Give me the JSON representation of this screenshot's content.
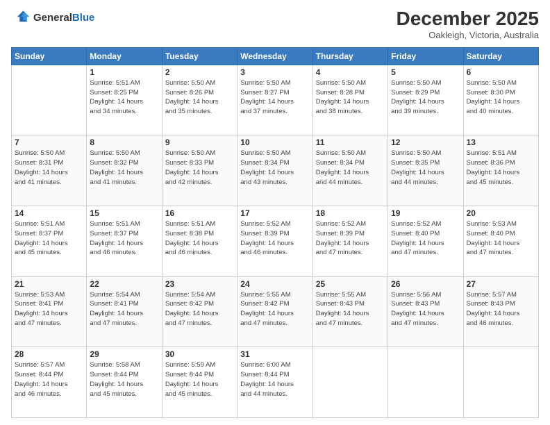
{
  "header": {
    "logo_line1": "General",
    "logo_line2": "Blue",
    "month": "December 2025",
    "location": "Oakleigh, Victoria, Australia"
  },
  "weekdays": [
    "Sunday",
    "Monday",
    "Tuesday",
    "Wednesday",
    "Thursday",
    "Friday",
    "Saturday"
  ],
  "weeks": [
    [
      {
        "day": "",
        "info": ""
      },
      {
        "day": "1",
        "info": "Sunrise: 5:51 AM\nSunset: 8:25 PM\nDaylight: 14 hours\nand 34 minutes."
      },
      {
        "day": "2",
        "info": "Sunrise: 5:50 AM\nSunset: 8:26 PM\nDaylight: 14 hours\nand 35 minutes."
      },
      {
        "day": "3",
        "info": "Sunrise: 5:50 AM\nSunset: 8:27 PM\nDaylight: 14 hours\nand 37 minutes."
      },
      {
        "day": "4",
        "info": "Sunrise: 5:50 AM\nSunset: 8:28 PM\nDaylight: 14 hours\nand 38 minutes."
      },
      {
        "day": "5",
        "info": "Sunrise: 5:50 AM\nSunset: 8:29 PM\nDaylight: 14 hours\nand 39 minutes."
      },
      {
        "day": "6",
        "info": "Sunrise: 5:50 AM\nSunset: 8:30 PM\nDaylight: 14 hours\nand 40 minutes."
      }
    ],
    [
      {
        "day": "7",
        "info": "Sunrise: 5:50 AM\nSunset: 8:31 PM\nDaylight: 14 hours\nand 41 minutes."
      },
      {
        "day": "8",
        "info": "Sunrise: 5:50 AM\nSunset: 8:32 PM\nDaylight: 14 hours\nand 41 minutes."
      },
      {
        "day": "9",
        "info": "Sunrise: 5:50 AM\nSunset: 8:33 PM\nDaylight: 14 hours\nand 42 minutes."
      },
      {
        "day": "10",
        "info": "Sunrise: 5:50 AM\nSunset: 8:34 PM\nDaylight: 14 hours\nand 43 minutes."
      },
      {
        "day": "11",
        "info": "Sunrise: 5:50 AM\nSunset: 8:34 PM\nDaylight: 14 hours\nand 44 minutes."
      },
      {
        "day": "12",
        "info": "Sunrise: 5:50 AM\nSunset: 8:35 PM\nDaylight: 14 hours\nand 44 minutes."
      },
      {
        "day": "13",
        "info": "Sunrise: 5:51 AM\nSunset: 8:36 PM\nDaylight: 14 hours\nand 45 minutes."
      }
    ],
    [
      {
        "day": "14",
        "info": "Sunrise: 5:51 AM\nSunset: 8:37 PM\nDaylight: 14 hours\nand 45 minutes."
      },
      {
        "day": "15",
        "info": "Sunrise: 5:51 AM\nSunset: 8:37 PM\nDaylight: 14 hours\nand 46 minutes."
      },
      {
        "day": "16",
        "info": "Sunrise: 5:51 AM\nSunset: 8:38 PM\nDaylight: 14 hours\nand 46 minutes."
      },
      {
        "day": "17",
        "info": "Sunrise: 5:52 AM\nSunset: 8:39 PM\nDaylight: 14 hours\nand 46 minutes."
      },
      {
        "day": "18",
        "info": "Sunrise: 5:52 AM\nSunset: 8:39 PM\nDaylight: 14 hours\nand 47 minutes."
      },
      {
        "day": "19",
        "info": "Sunrise: 5:52 AM\nSunset: 8:40 PM\nDaylight: 14 hours\nand 47 minutes."
      },
      {
        "day": "20",
        "info": "Sunrise: 5:53 AM\nSunset: 8:40 PM\nDaylight: 14 hours\nand 47 minutes."
      }
    ],
    [
      {
        "day": "21",
        "info": "Sunrise: 5:53 AM\nSunset: 8:41 PM\nDaylight: 14 hours\nand 47 minutes."
      },
      {
        "day": "22",
        "info": "Sunrise: 5:54 AM\nSunset: 8:41 PM\nDaylight: 14 hours\nand 47 minutes."
      },
      {
        "day": "23",
        "info": "Sunrise: 5:54 AM\nSunset: 8:42 PM\nDaylight: 14 hours\nand 47 minutes."
      },
      {
        "day": "24",
        "info": "Sunrise: 5:55 AM\nSunset: 8:42 PM\nDaylight: 14 hours\nand 47 minutes."
      },
      {
        "day": "25",
        "info": "Sunrise: 5:55 AM\nSunset: 8:43 PM\nDaylight: 14 hours\nand 47 minutes."
      },
      {
        "day": "26",
        "info": "Sunrise: 5:56 AM\nSunset: 8:43 PM\nDaylight: 14 hours\nand 47 minutes."
      },
      {
        "day": "27",
        "info": "Sunrise: 5:57 AM\nSunset: 8:43 PM\nDaylight: 14 hours\nand 46 minutes."
      }
    ],
    [
      {
        "day": "28",
        "info": "Sunrise: 5:57 AM\nSunset: 8:44 PM\nDaylight: 14 hours\nand 46 minutes."
      },
      {
        "day": "29",
        "info": "Sunrise: 5:58 AM\nSunset: 8:44 PM\nDaylight: 14 hours\nand 45 minutes."
      },
      {
        "day": "30",
        "info": "Sunrise: 5:59 AM\nSunset: 8:44 PM\nDaylight: 14 hours\nand 45 minutes."
      },
      {
        "day": "31",
        "info": "Sunrise: 6:00 AM\nSunset: 8:44 PM\nDaylight: 14 hours\nand 44 minutes."
      },
      {
        "day": "",
        "info": ""
      },
      {
        "day": "",
        "info": ""
      },
      {
        "day": "",
        "info": ""
      }
    ]
  ]
}
